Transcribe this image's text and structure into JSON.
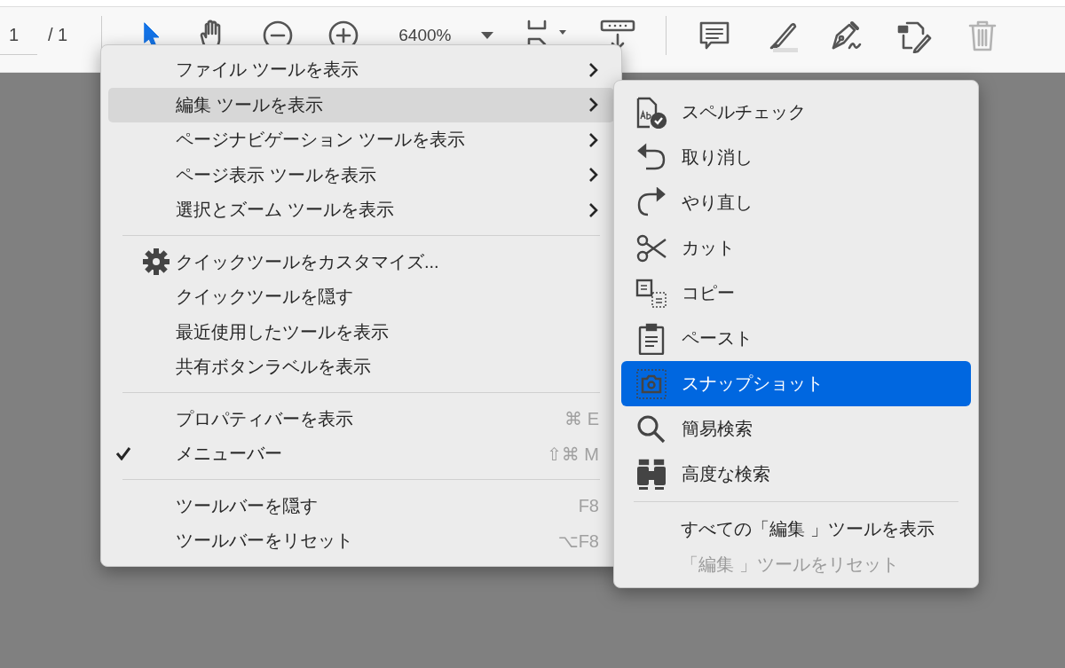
{
  "toolbar": {
    "page_field": {
      "value": "1"
    },
    "page_total": "/ 1",
    "zoom": "6400%",
    "tools": [
      {
        "kind": "pointer",
        "selected": true,
        "disabled": false
      },
      {
        "kind": "hand",
        "selected": false,
        "disabled": false
      },
      {
        "kind": "zoom-out",
        "selected": false,
        "disabled": false
      },
      {
        "kind": "zoom-in",
        "selected": false,
        "disabled": false
      },
      {
        "kind": "fit",
        "selected": false,
        "disabled": false
      },
      {
        "kind": "scroll",
        "selected": false,
        "disabled": false
      },
      {
        "kind": "comment",
        "selected": false,
        "disabled": false
      },
      {
        "kind": "highlight",
        "selected": false,
        "disabled": false
      },
      {
        "kind": "sign",
        "selected": false,
        "disabled": false
      },
      {
        "kind": "edit",
        "selected": false,
        "disabled": false
      },
      {
        "kind": "trash",
        "selected": false,
        "disabled": true
      }
    ]
  },
  "main_menu": {
    "sections": [
      {
        "items": [
          {
            "kind": "submenu",
            "label": "ファイル ツールを表示",
            "selected": false,
            "checked": false
          },
          {
            "kind": "submenu",
            "label": "編集 ツールを表示",
            "selected": true,
            "checked": false
          },
          {
            "kind": "submenu",
            "label": "ページナビゲーション ツールを表示",
            "selected": false,
            "checked": false
          },
          {
            "kind": "submenu",
            "label": "ページ表示 ツールを表示",
            "selected": false,
            "checked": false
          },
          {
            "kind": "submenu",
            "label": "選択とズーム ツールを表示",
            "selected": false,
            "checked": false
          }
        ]
      },
      {
        "items": [
          {
            "kind": "settings",
            "label": "クイックツールをカスタマイズ...",
            "selected": false,
            "checked": false
          },
          {
            "kind": "command",
            "label": "クイックツールを隠す",
            "selected": false,
            "checked": false
          },
          {
            "kind": "command",
            "label": "最近使用したツールを表示",
            "selected": false,
            "checked": false
          },
          {
            "kind": "command",
            "label": "共有ボタンラベルを表示",
            "selected": false,
            "checked": false
          }
        ]
      },
      {
        "items": [
          {
            "kind": "command",
            "label": "プロパティバーを表示",
            "shortcut": "⌘ E",
            "selected": false,
            "checked": false
          },
          {
            "kind": "command",
            "label": "メニューバー",
            "shortcut": "⇧⌘ M",
            "selected": false,
            "checked": true
          }
        ]
      },
      {
        "items": [
          {
            "kind": "command",
            "label": "ツールバーを隠す",
            "shortcut": "F8",
            "selected": false,
            "checked": false
          },
          {
            "kind": "command",
            "label": "ツールバーをリセット",
            "shortcut": "⌥F8",
            "selected": false,
            "checked": false
          }
        ]
      }
    ]
  },
  "submenu": {
    "sections": [
      {
        "items": [
          {
            "kind": "spellcheck",
            "label": "スペルチェック",
            "selected": false,
            "disabled": false
          },
          {
            "kind": "undo",
            "label": "取り消し",
            "selected": false,
            "disabled": false
          },
          {
            "kind": "redo",
            "label": "やり直し",
            "selected": false,
            "disabled": false
          },
          {
            "kind": "cut",
            "label": "カット",
            "selected": false,
            "disabled": false
          },
          {
            "kind": "copy",
            "label": "コピー",
            "selected": false,
            "disabled": false
          },
          {
            "kind": "paste",
            "label": "ペースト",
            "selected": false,
            "disabled": false
          },
          {
            "kind": "snapshot",
            "label": "スナップショット",
            "selected": true,
            "disabled": false
          },
          {
            "kind": "search",
            "label": "簡易検索",
            "selected": false,
            "disabled": false
          },
          {
            "kind": "advanced-search",
            "label": "高度な検索",
            "selected": false,
            "disabled": false
          }
        ]
      },
      {
        "items": [
          {
            "kind": "command",
            "label": "すべての「編集 」ツールを表示",
            "selected": false,
            "disabled": false
          },
          {
            "kind": "command",
            "label": "「編集 」ツールをリセット",
            "selected": false,
            "disabled": true
          }
        ]
      }
    ]
  }
}
